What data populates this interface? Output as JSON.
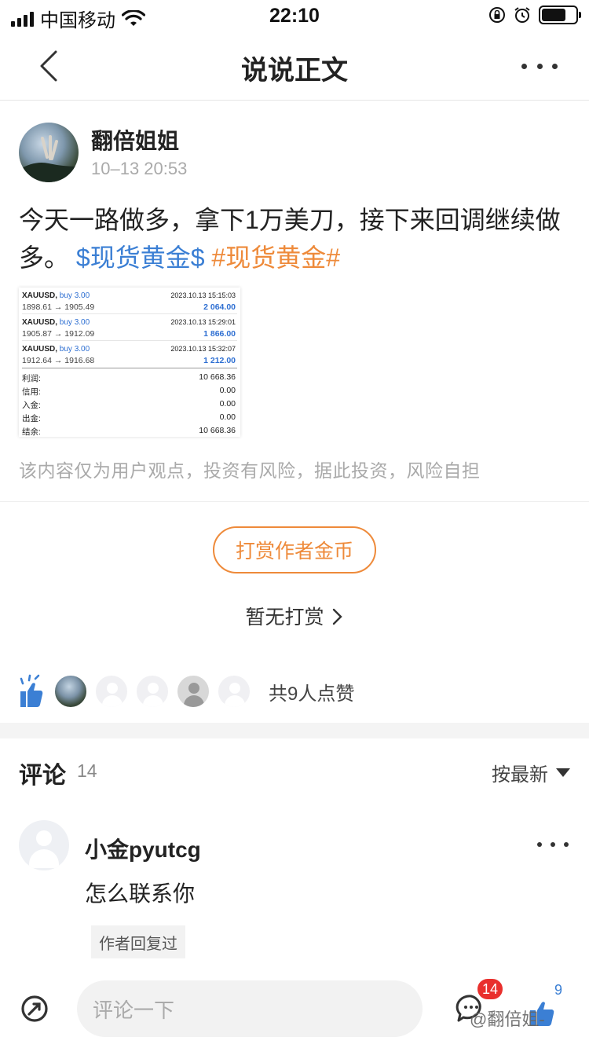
{
  "status_bar": {
    "carrier": "中国移动",
    "time": "22:10"
  },
  "nav": {
    "title": "说说正文",
    "back_icon": "chevron-left-icon",
    "more_icon": "more-dots-icon"
  },
  "post": {
    "author": "翻倍姐姐",
    "time": "10–13 20:53",
    "text": "今天一路做多，拿下1万美刀，接下来回调继续做多。",
    "tag_blue": "$现货黄金$",
    "tag_orange": "#现货黄金#",
    "disclaimer": "该内容仅为用户观点，投资有风险，据此投资，风险自担"
  },
  "trade_image": {
    "trades": [
      {
        "symbol": "XAUUSD,",
        "side": "buy 3.00",
        "datetime": "2023.10.13 15:15:03",
        "prices": "1898.61 → 1905.49",
        "profit": "2 064.00"
      },
      {
        "symbol": "XAUUSD,",
        "side": "buy 3.00",
        "datetime": "2023.10.13 15:29:01",
        "prices": "1905.87 → 1912.09",
        "profit": "1 866.00"
      },
      {
        "symbol": "XAUUSD,",
        "side": "buy 3.00",
        "datetime": "2023.10.13 15:32:07",
        "prices": "1912.64 → 1916.68",
        "profit": "1 212.00"
      }
    ],
    "summary": [
      {
        "label": "利润:",
        "value": "10 668.36"
      },
      {
        "label": "信用:",
        "value": "0.00"
      },
      {
        "label": "入金:",
        "value": "0.00"
      },
      {
        "label": "出金:",
        "value": "0.00"
      },
      {
        "label": "结余:",
        "value": "10 668.36"
      }
    ]
  },
  "tip": {
    "button": "打赏作者金币",
    "status": "暂无打赏"
  },
  "likes": {
    "text": "共9人点赞",
    "icon": "thumbs-up-icon"
  },
  "comments": {
    "title": "评论",
    "count": "14",
    "sort": "按最新",
    "items": [
      {
        "name": "小金pyutcg",
        "text": "怎么联系你",
        "badge": "作者回复过"
      }
    ]
  },
  "bottom_bar": {
    "input_placeholder": "评论一下",
    "comment_badge": "14",
    "like_count": "9",
    "watermark": "@翻倍姐-"
  },
  "colors": {
    "accent_orange": "#ee8a3a",
    "tag_blue": "#3b7fd4",
    "badge_red": "#e9302d"
  }
}
